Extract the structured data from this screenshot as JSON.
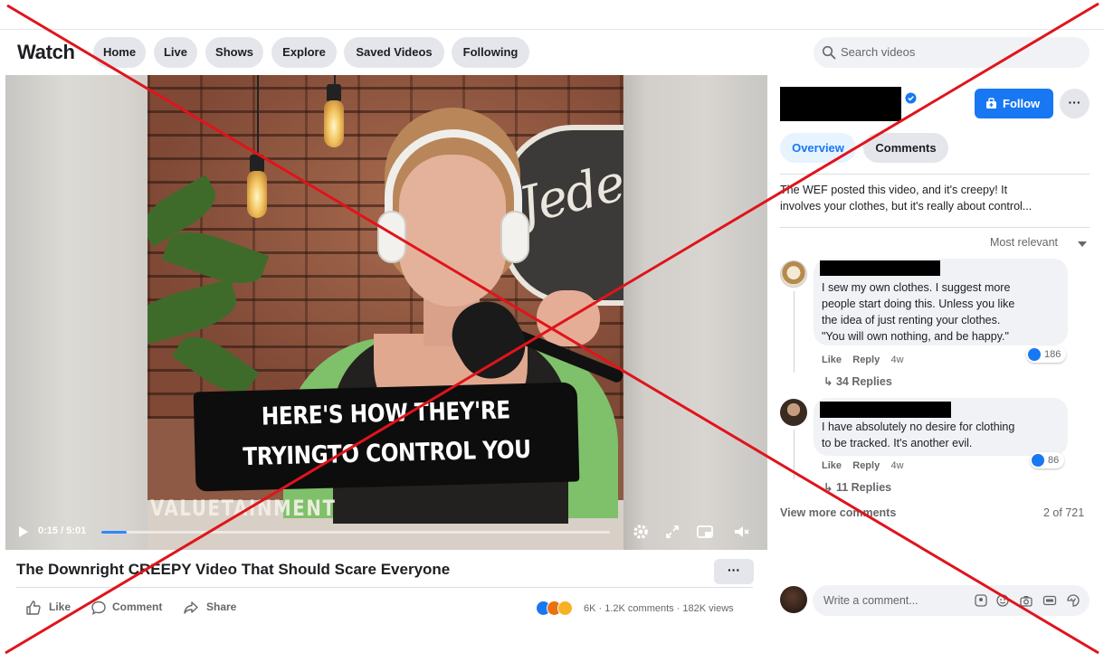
{
  "topbar": {
    "brand": "Watch",
    "nav": [
      "Home",
      "Live",
      "Shows",
      "Explore",
      "Saved Videos",
      "Following"
    ],
    "search_placeholder": "Search videos"
  },
  "video": {
    "caption_line1": "HERE'S HOW THEY'RE",
    "caption_line2": "TRYINGTO CONTROL YOU",
    "sign_text": "Jede",
    "watermark": "VALUETAINMENT",
    "time": "0:15 / 5:01",
    "progress": 0.05
  },
  "post": {
    "title": "The Downright CREEPY Video That Should Scare Everyone",
    "more_label": "···",
    "like_label": "Like",
    "comment_label": "Comment",
    "share_label": "Share",
    "stats": "6K · 1.2K comments · 182K views"
  },
  "panel": {
    "follow_label": "Follow",
    "dots_label": "···",
    "tab_overview": "Overview",
    "tab_comments": "Comments",
    "description_line1": "The WEF posted this video, and it's creepy! It",
    "description_line2": "involves your clothes, but it's really about control...",
    "sort_label": "Most relevant",
    "comments": [
      {
        "lines": [
          "I sew my own clothes. I suggest more",
          "people start doing this. Unless you like",
          "the idea of just renting your clothes.",
          "\"You will own nothing, and be happy.\""
        ],
        "like": "Like",
        "reply": "Reply",
        "time": "4w",
        "reactions": "186",
        "replies": "34 Replies"
      },
      {
        "lines": [
          "I have absolutely no desire for clothing",
          "to be tracked. It's another evil."
        ],
        "like": "Like",
        "reply": "Reply",
        "time": "4w",
        "reactions": "86",
        "replies": "11 Replies"
      }
    ],
    "view_more": "View more comments",
    "count": "2 of 721",
    "composer_placeholder": "Write a comment..."
  },
  "colors": {
    "accent": "#1877f2",
    "overlay_x": "#e0141b"
  }
}
